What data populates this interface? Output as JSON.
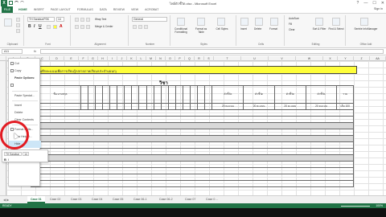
{
  "window": {
    "title": "ไฟล์ตัวชี้วัด.xlsx - Microsoft Excel",
    "app_icon_label": "X",
    "controls": [
      "?",
      "—",
      "☐",
      "✕"
    ]
  },
  "ribbon_tabs": {
    "file": "FILE",
    "items": [
      "HOME",
      "INSERT",
      "PAGE LAYOUT",
      "FORMULAS",
      "DATA",
      "REVIEW",
      "VIEW",
      "ACROBAT"
    ],
    "active_index": 0,
    "signin": "Sign in"
  },
  "ribbon": {
    "font_name": "TH SarabunPSK",
    "font_size": "14",
    "number_format": "General",
    "wrap_text": "Wrap Text",
    "merge_center": "Merge & Center",
    "conditional_formatting": "Conditional Formatting",
    "format_as_table": "Format as Table",
    "cell_styles": "Cell Styles",
    "insert": "Insert",
    "delete": "Delete",
    "format": "Format",
    "autosum": "AutoSum",
    "fill": "Fill",
    "clear": "Clear",
    "sort_filter": "Sort & Filter",
    "find_select": "Find & Select",
    "sentrie": "Sentrie InfoManager",
    "groups": [
      "Clipboard",
      "Font",
      "Alignment",
      "Number",
      "Styles",
      "Cells",
      "Editing",
      "Office Add"
    ]
  },
  "formula_bar": {
    "name_box": "A11",
    "fx": "fx",
    "formula": ""
  },
  "columns": [
    "A",
    "B",
    "C",
    "D",
    "E",
    "F",
    "G",
    "H",
    "I",
    "J",
    "K",
    "L",
    "M",
    "N",
    "O",
    "P",
    "Q",
    "R",
    "S",
    "T",
    "U",
    "V",
    "W",
    "X",
    "Y",
    "Z",
    "AA"
  ],
  "sheet": {
    "yellow_header": "...นี (ระบบบันทึกคะแนนเพื่อการเรียนรู้/ปลายภาคเรียน/ประจำแผนก)",
    "subject_header": "วิชา",
    "name_col_header": "ชื่อ-นามสกุล",
    "score_headers": [
      "ตัวชี้วัด",
      "ตัวชี้วัด",
      "ตัวชี้วัด",
      "ตัวชี้วัด"
    ],
    "score_points": [
      "20 คะแนน",
      "20 คะแนน",
      "20 คะแนน",
      "20 คะแนน"
    ],
    "total_header": "รวม",
    "total_points": "เต็ม 100"
  },
  "context_menu": {
    "items": [
      "Cut",
      "Copy",
      "Paste Options:",
      "",
      "Paste Special...",
      "Insert",
      "Delete",
      "Clear Contents",
      "Format Cells...",
      "Row Height...",
      "Hide",
      "Unhide"
    ],
    "highlighted_index": 10
  },
  "mini_toolbar": {
    "font": "TH Sarabun",
    "size": "14",
    "bold": "B",
    "italic": "I"
  },
  "sheet_tabs": {
    "nav": "◀ ▶",
    "tabs": [
      "Case 01",
      "Case 02",
      "Case 03",
      "Case 04",
      "Case 05",
      "Case 06-1",
      "Case 06-2",
      "Case 07",
      "Case 0 ..."
    ],
    "active_index": 0
  },
  "status": {
    "ready": "READY",
    "zoom": "100%"
  }
}
